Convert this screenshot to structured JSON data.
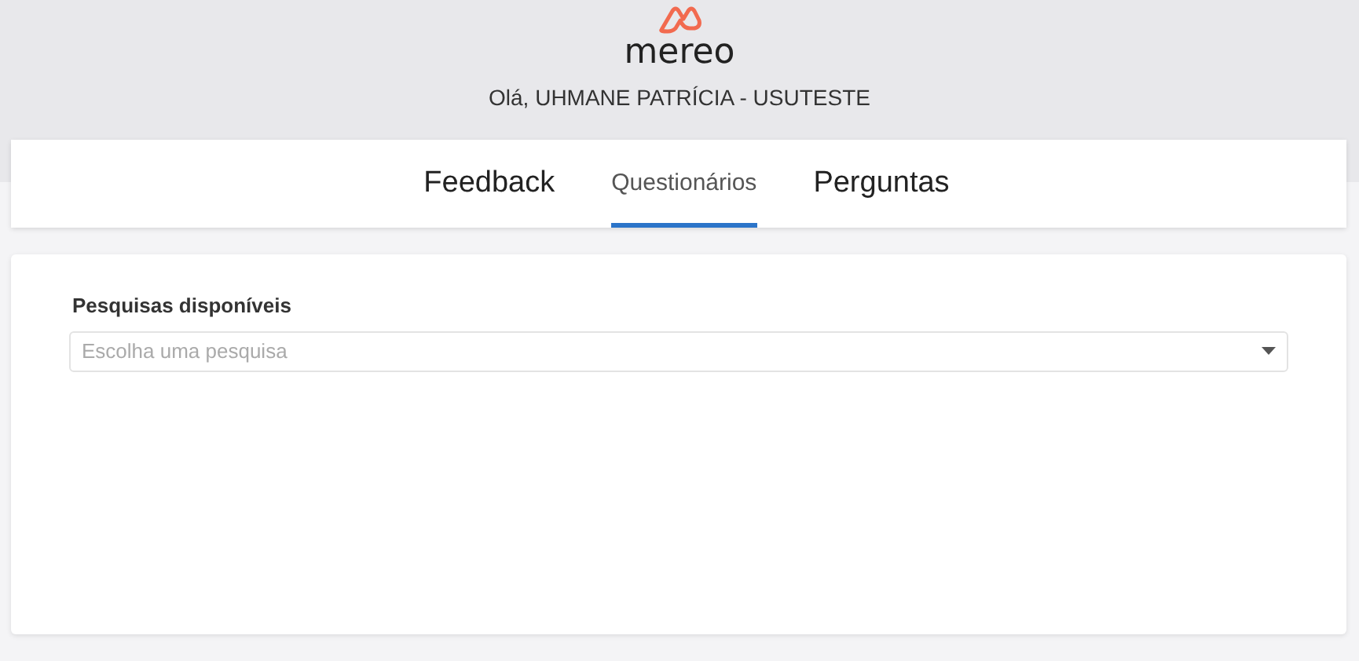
{
  "header": {
    "logo_text": "mereo",
    "greeting": "Olá, UHMANE PATRÍCIA - USUTESTE"
  },
  "tabs": [
    {
      "label": "Feedback",
      "selected": false
    },
    {
      "label": "Questionários",
      "selected": true
    },
    {
      "label": "Perguntas",
      "selected": false
    }
  ],
  "form": {
    "label": "Pesquisas disponíveis",
    "select": {
      "placeholder": "Escolha uma pesquisa"
    }
  }
}
